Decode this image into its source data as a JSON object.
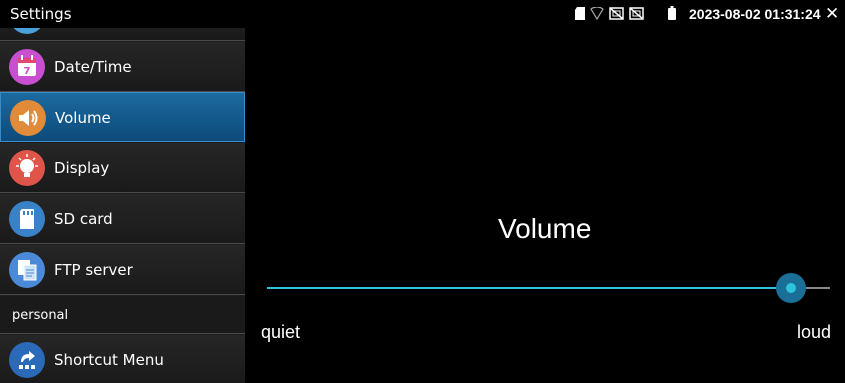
{
  "status_bar": {
    "app_title": "Settings",
    "datetime": "2023-08-02 01:31:24",
    "icons": [
      "sd-card-icon",
      "wifi-icon",
      "network-disabled-icon",
      "display-disabled-icon",
      "battery-icon"
    ],
    "close_label": "✕"
  },
  "sidebar": {
    "items": [
      {
        "label": "Date/Time",
        "icon": "calendar-icon",
        "color": "#c94fd0",
        "selected": false
      },
      {
        "label": "Volume",
        "icon": "speaker-icon",
        "color": "#e08a3a",
        "selected": true
      },
      {
        "label": "Display",
        "icon": "lightbulb-icon",
        "color": "#e0554a",
        "selected": false
      },
      {
        "label": "SD card",
        "icon": "sd-card-icon",
        "color": "#3a82c8",
        "selected": false
      },
      {
        "label": "FTP server",
        "icon": "ftp-icon",
        "color": "#4a8ad8",
        "selected": false
      }
    ],
    "section_header": "personal",
    "personal_items": [
      {
        "label": "Shortcut Menu",
        "icon": "shortcut-icon",
        "color": "#2a6ab8"
      }
    ]
  },
  "main": {
    "title": "Volume",
    "min_label": "quiet",
    "max_label": "loud",
    "volume_level": 0.93
  },
  "colors": {
    "accent": "#2ec4dc",
    "selected_bg": "#1c6aa0"
  }
}
